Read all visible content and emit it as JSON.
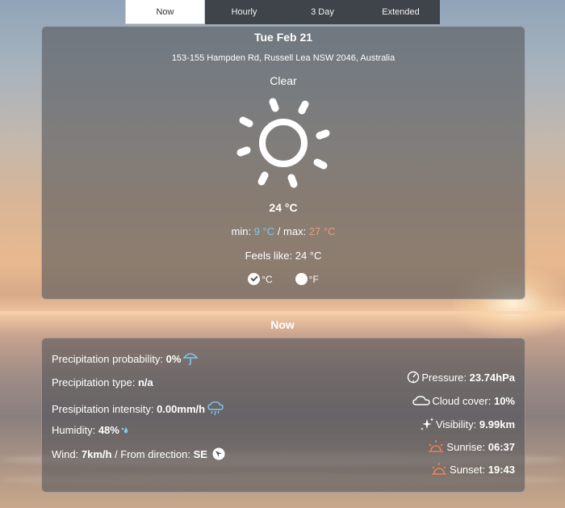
{
  "tabs": [
    "Now",
    "Hourly",
    "3 Day",
    "Extended"
  ],
  "current": {
    "date": "Tue Feb 21",
    "address": "153-155 Hampden Rd, Russell Lea NSW 2046, Australia",
    "condition": "Clear",
    "condition_icon": "sun-icon",
    "temperature": "24 °C",
    "min_label": "min:",
    "min_value": "9 °C",
    "separator": "/",
    "max_label": "max:",
    "max_value": "27 °C",
    "feels_like": "Feels like: 24 °C",
    "units": [
      {
        "label": "°C",
        "selected": true
      },
      {
        "label": "°F",
        "selected": false
      }
    ]
  },
  "section_title": "Now",
  "details": {
    "precip_probability": {
      "label": "Precipitation probability:",
      "value": "0%"
    },
    "precip_type": {
      "label": "Precipitation type:",
      "value": "n/a"
    },
    "precip_intensity": {
      "label": "Presipitation intensity:",
      "value": "0.00mm/h"
    },
    "humidity": {
      "label": "Humidity:",
      "value": "48%"
    },
    "wind": {
      "label": "Wind:",
      "value": "7km/h",
      "direction_label": "/ From direction:",
      "direction_value": "SE"
    },
    "pressure": {
      "label": "Pressure:",
      "value": "23.74hPa"
    },
    "cloud_cover": {
      "label": "Cloud cover:",
      "value": "10%"
    },
    "visibility": {
      "label": "Visibility:",
      "value": "9.99km"
    },
    "sunrise": {
      "label": "Sunrise:",
      "value": "06:37"
    },
    "sunset": {
      "label": "Sunset:",
      "value": "19:43"
    }
  },
  "colors": {
    "min": "#7fc8ee",
    "max": "#f0997a",
    "accent_icon": "#7fc8ee",
    "sun_icon": "#e8815a"
  }
}
